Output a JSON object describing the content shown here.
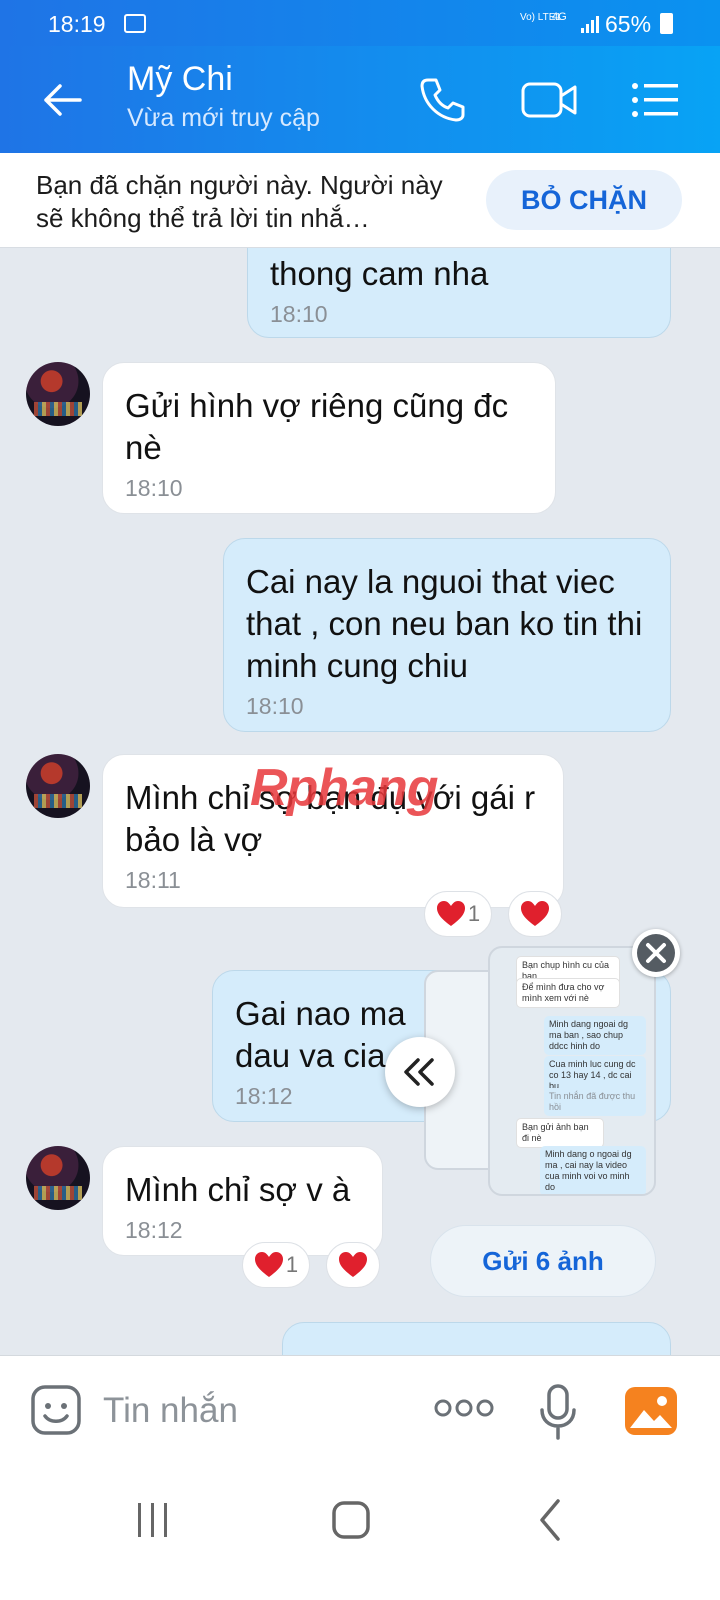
{
  "status": {
    "time": "18:19",
    "net": "Vo) LTE1",
    "cell": "4G",
    "battery": "65%"
  },
  "header": {
    "name": "Mỹ Chi",
    "subtitle": "Vừa mới truy cập"
  },
  "blocked": {
    "message": "Bạn đã chặn người này. Người này sẽ không thể trả lời tin nhắ…",
    "unblock_label": "BỎ CHẶN"
  },
  "messages": [
    {
      "dir": "out",
      "text": "thong cam nha",
      "time": "18:10"
    },
    {
      "dir": "in",
      "text": "Gửi hình vợ riêng cũng đc nè",
      "time": "18:10"
    },
    {
      "dir": "out",
      "text": "Cai nay la nguoi that viec that , con neu ban ko tin thi minh cung chiu",
      "time": "18:10"
    },
    {
      "dir": "in",
      "text": "Mình chỉ sợ bạn đụ với gái r bảo là vợ",
      "time": "18:11",
      "reaction_count": "1"
    },
    {
      "dir": "out",
      "text": "Gai nao ma dau va cia",
      "time": "18:12"
    },
    {
      "dir": "in",
      "text": "Mình chỉ sợ v à",
      "time": "18:12",
      "reaction_count": "1"
    }
  ],
  "preview": {
    "items": [
      {
        "dir": "in",
        "text": "Bạn chụp hình cu của bạn"
      },
      {
        "dir": "in",
        "text": "Để mình đưa cho vợ mình xem với nè"
      },
      {
        "dir": "out",
        "text": "Minh dang ngoai dg ma ban , sao chup ddcc hinh do"
      },
      {
        "dir": "out",
        "text": "Cua minh luc cung dc co 13 hay 14 , dc cai bu"
      },
      {
        "dir": "out",
        "text": "Tin nhắn đã được thu hồi"
      },
      {
        "dir": "in",
        "text": "Bạn gửi ảnh bạn đi nè"
      },
      {
        "dir": "out",
        "text": "Minh dang o ngoai dg ma , cai nay la video cua minh voi vo minh do"
      }
    ]
  },
  "send_photos_label": "Gửi 6 ảnh",
  "watermark": {
    "part1": "Rphang",
    "part2": ""
  },
  "input": {
    "placeholder": "Tin nhắn"
  },
  "icons": {
    "back": "back-arrow-icon",
    "call": "phone-icon",
    "video": "video-call-icon",
    "menu": "menu-icon"
  },
  "colors": {
    "header": "#1f74e6",
    "accent": "#1565d8",
    "out_bubble": "#d5ecfb",
    "heart": "#e0202d"
  }
}
